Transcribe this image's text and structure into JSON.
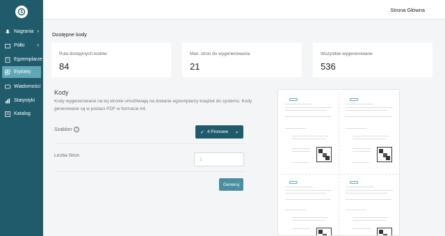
{
  "sidebar": {
    "items": [
      {
        "label": "Nagrania",
        "icon": "microphone-icon",
        "has_chevron": true
      },
      {
        "label": "Półki",
        "icon": "folder-icon",
        "has_chevron": true
      },
      {
        "label": "Egzemplarze",
        "icon": "book-icon",
        "has_chevron": false
      },
      {
        "label": "Etykiety",
        "icon": "qr-code-icon",
        "has_chevron": false,
        "active": true
      },
      {
        "label": "Wiadomości",
        "icon": "message-icon",
        "has_chevron": false
      },
      {
        "label": "Statystyki",
        "icon": "chart-icon",
        "has_chevron": false
      },
      {
        "label": "Katalog",
        "icon": "catalog-icon",
        "has_chevron": false
      }
    ]
  },
  "topbar": {
    "home_link": "Strona Główna"
  },
  "stats": {
    "title": "Dostępne kody",
    "cards": [
      {
        "label": "Pula dostępnych kodów",
        "value": "84"
      },
      {
        "label": "Max. stron do wygenerowania",
        "value": "21"
      },
      {
        "label": "Wszystkie wygenerowane",
        "value": "536"
      }
    ]
  },
  "form": {
    "title": "Kody",
    "description": "Kody wygenerowane na tej stronie umożliwiają na dodanie egzemplarzy książek do systemu. Kody generowane są w postaci PDF w formacie A4.",
    "template_label": "Szablon",
    "template_value": "4 Pionowe",
    "pages_label": "Liczba Stron",
    "pages_placeholder": "1",
    "generate_button": "Generuj"
  },
  "colors": {
    "sidebar": "#1f5b6a",
    "accent": "#5fa7b6",
    "button": "#4a8e9f"
  }
}
